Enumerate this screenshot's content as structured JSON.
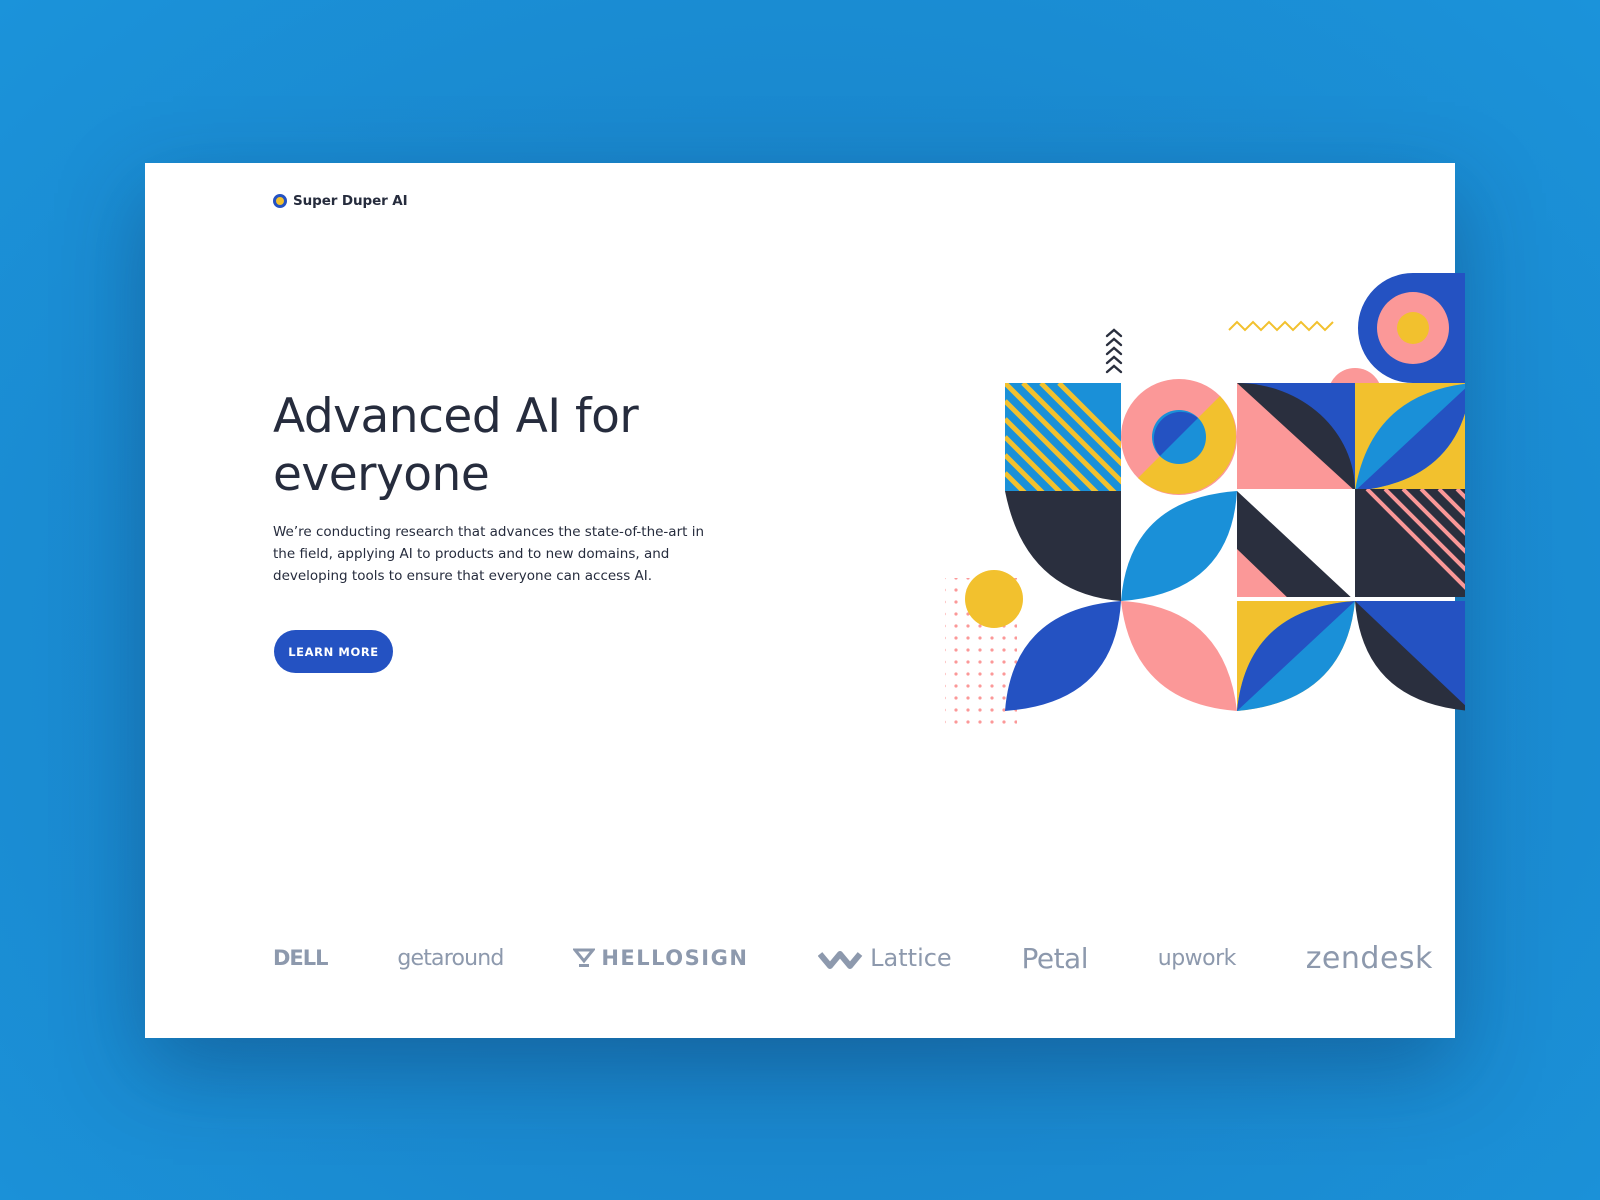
{
  "brand": {
    "name": "Super Duper AI"
  },
  "hero": {
    "title": "Advanced AI for everyone",
    "body": "We’re conducting research that advances the state-of-the-art in the field, applying AI to products and to new domains, and developing tools to ensure that everyone can access AI.",
    "cta_label": "LEARN MORE"
  },
  "logos": [
    "DELL",
    "getaround",
    "HELLOSIGN",
    "Lattice",
    "Petal",
    "upwork",
    "zendesk"
  ],
  "colors": {
    "page_background": "#1b8fd6",
    "card_background": "#ffffff",
    "text_dark": "#262c3d",
    "accent_blue": "#2452c2",
    "sky_blue": "#1a90d8",
    "pink": "#fb9898",
    "yellow": "#f2c12e",
    "navy": "#2a2f3e",
    "logo_gray": "#8d99ad"
  },
  "icons": {
    "brand": "brand-dot-icon",
    "hellosign": "hellosign-mark-icon",
    "lattice": "lattice-mark-icon"
  }
}
